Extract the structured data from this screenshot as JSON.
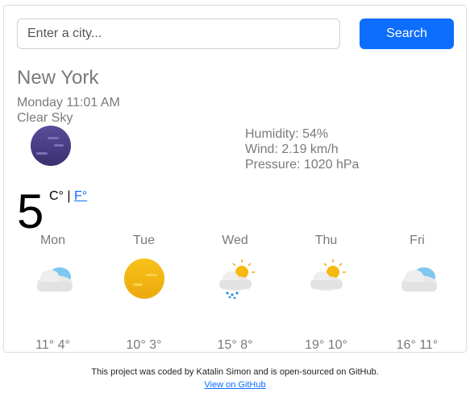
{
  "search": {
    "placeholder": "Enter a city...",
    "button_label": "Search"
  },
  "current": {
    "city": "New York",
    "datetime": "Monday 11:01 AM",
    "description": "Clear Sky",
    "icon": "night-clear-moon-icon",
    "humidity": "Humidity: 54%",
    "wind": "Wind: 2.19 km/h",
    "pressure": "Pressure: 1020 hPa",
    "temperature": "5",
    "unit_c": "C°",
    "unit_sep": " | ",
    "unit_f": "F°"
  },
  "forecast": [
    {
      "day": "Mon",
      "icon": "cloud-icon",
      "max": "11°",
      "min": "4°"
    },
    {
      "day": "Tue",
      "icon": "sun-icon",
      "max": "10°",
      "min": "3°"
    },
    {
      "day": "Wed",
      "icon": "rain-sun-cloud-icon",
      "max": "15°",
      "min": "8°"
    },
    {
      "day": "Thu",
      "icon": "sun-cloud-icon",
      "max": "19°",
      "min": "10°"
    },
    {
      "day": "Fri",
      "icon": "cloud-icon",
      "max": "16°",
      "min": "11°"
    }
  ],
  "footer": {
    "text": "This project was coded by Katalin Simon and is open-sourced on GitHub.",
    "link_label": "View on GitHub"
  },
  "colors": {
    "accent": "#0d6efd",
    "moon": "#4b3f86",
    "sun": "#f5b90f",
    "cloud_blue": "#7cc8ee"
  }
}
